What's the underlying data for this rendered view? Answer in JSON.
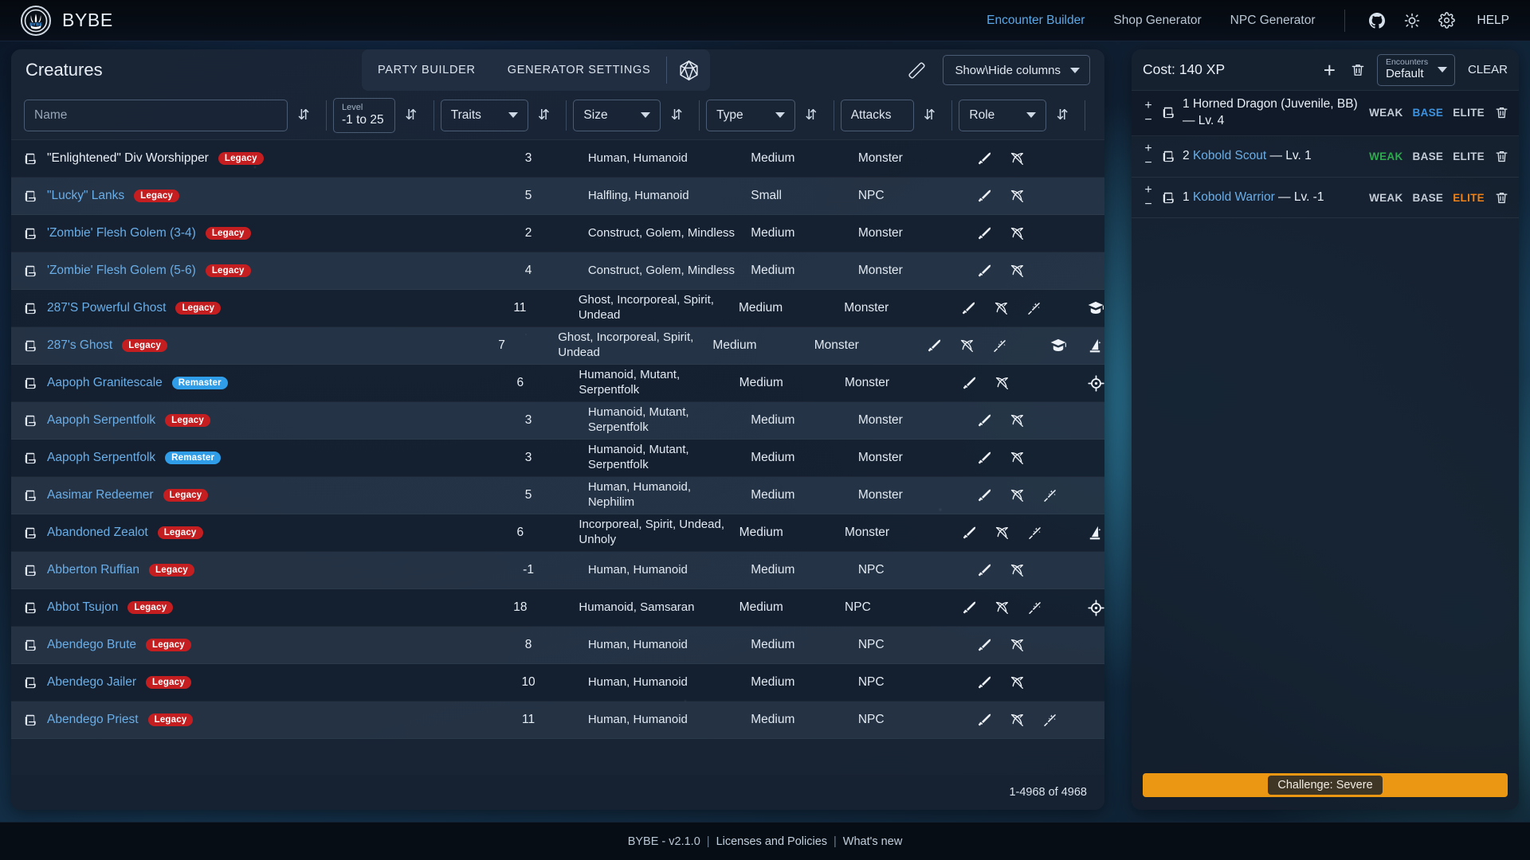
{
  "app": {
    "brand": "BYBE",
    "logo_text": "BYBE"
  },
  "nav": {
    "links": [
      {
        "label": "Encounter Builder",
        "active": true
      },
      {
        "label": "Shop Generator",
        "active": false
      },
      {
        "label": "NPC Generator",
        "active": false
      }
    ],
    "icons": [
      {
        "name": "github-icon"
      },
      {
        "name": "sun-theme-icon"
      },
      {
        "name": "gear-settings-icon"
      }
    ],
    "help_label": "HELP"
  },
  "creatures": {
    "title": "Creatures",
    "tabs": [
      {
        "label": "PARTY BUILDER"
      },
      {
        "label": "GENERATOR SETTINGS"
      }
    ],
    "dice_icon": "d20-dice-icon",
    "eraser_icon": "eraser-icon",
    "columns_select": "Show\\Hide columns",
    "filters": {
      "name_placeholder": "Name",
      "name_value": "",
      "level_label": "Level",
      "level_value": "-1 to 25",
      "traits_label": "Traits",
      "size_label": "Size",
      "type_label": "Type",
      "attacks_label": "Attacks",
      "role_label": "Role"
    },
    "pagination": "1-4968 of 4968",
    "rows": [
      {
        "name": "\"Enlightened\" Div Worshipper",
        "badge": "Legacy",
        "badge_kind": "legacy",
        "link": false,
        "level": "3",
        "traits": "Human, Humanoid",
        "size": "Medium",
        "type": "Monster",
        "attacks": [
          "sword-icon",
          "bow-icon"
        ],
        "roles": []
      },
      {
        "name": "\"Lucky\" Lanks",
        "badge": "Legacy",
        "badge_kind": "legacy",
        "link": true,
        "level": "5",
        "traits": "Halfling, Humanoid",
        "size": "Small",
        "type": "NPC",
        "attacks": [
          "sword-icon",
          "bow-icon"
        ],
        "roles": []
      },
      {
        "name": "'Zombie' Flesh Golem (3-4)",
        "badge": "Legacy",
        "badge_kind": "legacy",
        "link": true,
        "level": "2",
        "traits": "Construct, Golem, Mindless",
        "size": "Medium",
        "type": "Monster",
        "attacks": [
          "sword-icon",
          "bow-icon"
        ],
        "roles": []
      },
      {
        "name": "'Zombie' Flesh Golem (5-6)",
        "badge": "Legacy",
        "badge_kind": "legacy",
        "link": true,
        "level": "4",
        "traits": "Construct, Golem, Mindless",
        "size": "Medium",
        "type": "Monster",
        "attacks": [
          "sword-icon",
          "bow-icon"
        ],
        "roles": []
      },
      {
        "name": "287'S Powerful Ghost",
        "badge": "Legacy",
        "badge_kind": "legacy",
        "link": true,
        "level": "11",
        "traits": "Ghost, Incorporeal, Spirit, Undead",
        "size": "Medium",
        "type": "Monster",
        "attacks": [
          "sword-icon",
          "bow-icon",
          "wand-icon"
        ],
        "roles": [
          "graduation-cap-icon"
        ]
      },
      {
        "name": "287's Ghost",
        "badge": "Legacy",
        "badge_kind": "legacy",
        "link": true,
        "level": "7",
        "traits": "Ghost, Incorporeal, Spirit, Undead",
        "size": "Medium",
        "type": "Monster",
        "attacks": [
          "sword-icon",
          "bow-icon",
          "wand-icon"
        ],
        "roles": [
          "graduation-cap-icon",
          "wizard-hat-icon"
        ]
      },
      {
        "name": "Aapoph Granitescale",
        "badge": "Remaster",
        "badge_kind": "remaster",
        "link": true,
        "level": "6",
        "traits": "Humanoid, Mutant, Serpentfolk",
        "size": "Medium",
        "type": "Monster",
        "attacks": [
          "sword-icon",
          "bow-icon"
        ],
        "roles": [
          "target-icon"
        ]
      },
      {
        "name": "Aapoph Serpentfolk",
        "badge": "Legacy",
        "badge_kind": "legacy",
        "link": true,
        "level": "3",
        "traits": "Humanoid, Mutant, Serpentfolk",
        "size": "Medium",
        "type": "Monster",
        "attacks": [
          "sword-icon",
          "bow-icon"
        ],
        "roles": []
      },
      {
        "name": "Aapoph Serpentfolk",
        "badge": "Remaster",
        "badge_kind": "remaster",
        "link": true,
        "level": "3",
        "traits": "Humanoid, Mutant, Serpentfolk",
        "size": "Medium",
        "type": "Monster",
        "attacks": [
          "sword-icon",
          "bow-icon"
        ],
        "roles": []
      },
      {
        "name": "Aasimar Redeemer",
        "badge": "Legacy",
        "badge_kind": "legacy",
        "link": true,
        "level": "5",
        "traits": "Human, Humanoid, Nephilim",
        "size": "Medium",
        "type": "Monster",
        "attacks": [
          "sword-icon",
          "bow-icon",
          "wand-icon"
        ],
        "roles": []
      },
      {
        "name": "Abandoned Zealot",
        "badge": "Legacy",
        "badge_kind": "legacy",
        "link": true,
        "level": "6",
        "traits": "Incorporeal, Spirit, Undead, Unholy",
        "size": "Medium",
        "type": "Monster",
        "attacks": [
          "sword-icon",
          "bow-icon",
          "wand-icon"
        ],
        "roles": [
          "wizard-hat-icon"
        ]
      },
      {
        "name": "Abberton Ruffian",
        "badge": "Legacy",
        "badge_kind": "legacy",
        "link": true,
        "level": "-1",
        "traits": "Human, Humanoid",
        "size": "Medium",
        "type": "NPC",
        "attacks": [
          "sword-icon",
          "bow-icon"
        ],
        "roles": []
      },
      {
        "name": "Abbot Tsujon",
        "badge": "Legacy",
        "badge_kind": "legacy",
        "link": true,
        "level": "18",
        "traits": "Humanoid, Samsaran",
        "size": "Medium",
        "type": "NPC",
        "attacks": [
          "sword-icon",
          "bow-icon",
          "wand-icon"
        ],
        "roles": [
          "target-icon"
        ]
      },
      {
        "name": "Abendego Brute",
        "badge": "Legacy",
        "badge_kind": "legacy",
        "link": true,
        "level": "8",
        "traits": "Human, Humanoid",
        "size": "Medium",
        "type": "NPC",
        "attacks": [
          "sword-icon",
          "bow-icon"
        ],
        "roles": []
      },
      {
        "name": "Abendego Jailer",
        "badge": "Legacy",
        "badge_kind": "legacy",
        "link": true,
        "level": "10",
        "traits": "Human, Humanoid",
        "size": "Medium",
        "type": "NPC",
        "attacks": [
          "sword-icon",
          "bow-icon"
        ],
        "roles": []
      },
      {
        "name": "Abendego Priest",
        "badge": "Legacy",
        "badge_kind": "legacy",
        "link": true,
        "level": "11",
        "traits": "Human, Humanoid",
        "size": "Medium",
        "type": "NPC",
        "attacks": [
          "sword-icon",
          "bow-icon",
          "wand-icon"
        ],
        "roles": []
      }
    ]
  },
  "encounter": {
    "cost_label": "Cost: 140 XP",
    "add_icon": "plus-icon",
    "delete_icon": "trash-icon",
    "select_label": "Encounters",
    "select_value": "Default",
    "clear_label": "CLEAR",
    "adjust_labels": {
      "weak": "WEAK",
      "base": "BASE",
      "elite": "ELITE"
    },
    "items": [
      {
        "count": "1",
        "name": "Horned Dragon (Juvenile, BB)",
        "level": "Lv. 4",
        "link": false,
        "active": "base"
      },
      {
        "count": "2",
        "name": "Kobold Scout",
        "level": "Lv. 1",
        "link": true,
        "active": "weak"
      },
      {
        "count": "1",
        "name": "Kobold Warrior",
        "level": "Lv. -1",
        "link": true,
        "active": "elite"
      }
    ],
    "challenge": "Challenge: Severe"
  },
  "footer": {
    "version": "BYBE - v2.1.0",
    "licenses": "Licenses and Policies",
    "whats_new": "What's new",
    "sep": "|"
  },
  "colors": {
    "accent_blue": "#6aaee8",
    "legacy_red": "#c41e21",
    "remaster_blue": "#2f9de8",
    "weak_green": "#2fa84f",
    "elite_orange": "#ef8116",
    "challenge_orange": "#eb9713"
  }
}
